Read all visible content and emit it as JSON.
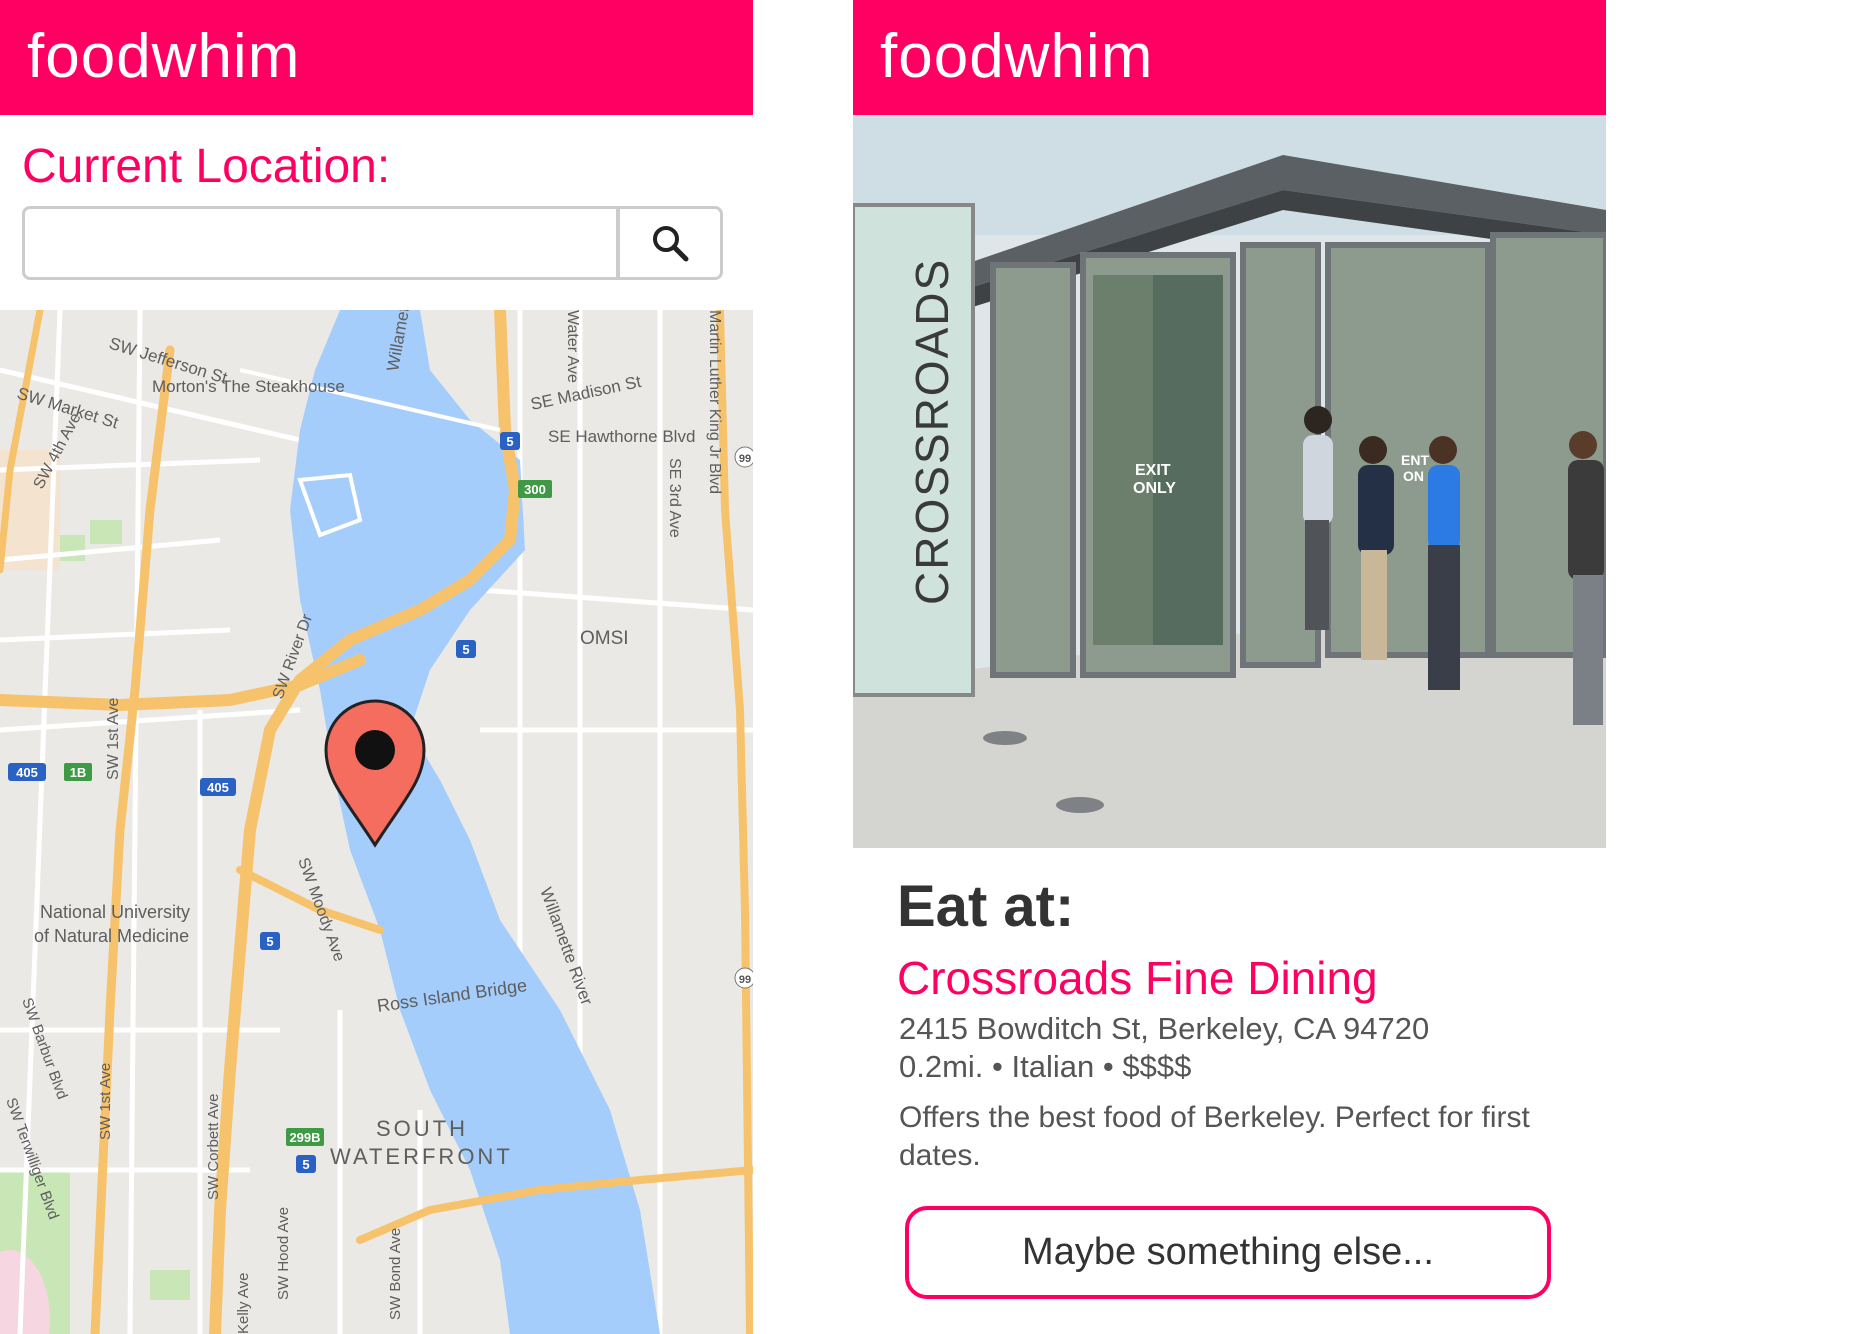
{
  "left_screen": {
    "app_title": "foodwhim",
    "location_label": "Current Location:",
    "search": {
      "value": "",
      "placeholder": "",
      "button_icon": "search-icon"
    },
    "map": {
      "pin_icon": "map-pin-icon",
      "labels": {
        "sw_jefferson": "SW Jefferson St",
        "mortons": "Morton's The Steakhouse",
        "sw_market": "SW Market St",
        "sw_4th": "SW 4th Ave",
        "willamette_top": "Willamette",
        "water_ave": "Water Ave",
        "mlk": "Martin Luther King Jr Blvd",
        "se_madison": "SE Madison St",
        "se_hawthorne": "SE Hawthorne Blvd",
        "se_3rd": "SE 3rd Ave",
        "sw_river": "SW River Dr",
        "omsi": "OMSI",
        "sw_1st": "SW 1st Ave",
        "sw_moody": "SW Moody Ave",
        "willamette_river": "Willamette River",
        "natl_univ_1": "National University",
        "natl_univ_2": "of Natural Medicine",
        "ross_island": "Ross Island Bridge",
        "sw_barbur": "SW Barbur Blvd",
        "sw_1st_b": "SW 1st Ave",
        "sw_corbett": "SW Corbett Ave",
        "sw_terwilliger": "SW Terwilliger Blvd",
        "south": "SOUTH",
        "waterfront": "WATERFRONT",
        "sw_hood": "SW Hood Ave",
        "sw_bond": "SW Bond Ave",
        "kelly": "Kelly Ave"
      },
      "shields": {
        "i5_a": "5",
        "i300": "300",
        "i5_b": "5",
        "i405_a": "405",
        "i1b": "1B",
        "i405_b": "405",
        "i5_c": "5",
        "i299b": "299B",
        "i5_d": "5",
        "i99_a": "99",
        "i99_b": "99"
      }
    }
  },
  "right_screen": {
    "app_title": "foodwhim",
    "photo_sign": "CROSSROADS",
    "door_sign_1": "EXIT",
    "door_sign_2": "ONLY",
    "door_sign_3": "ENT",
    "door_sign_4": "ON",
    "eat_label": "Eat at:",
    "restaurant": {
      "name": "Crossroads Fine Dining",
      "address": "2415 Bowditch St, Berkeley, CA 94720",
      "distance": "0.2mi.",
      "cuisine": "Italian",
      "price": "$$$$",
      "separator": "•",
      "description": "Offers the best food of Berkeley. Perfect for first dates."
    },
    "alt_button": "Maybe something else..."
  },
  "colors": {
    "brand": "#ff0062",
    "water": "#a5cdfb",
    "highway": "#f6c36c",
    "pin": "#f56d5e"
  }
}
